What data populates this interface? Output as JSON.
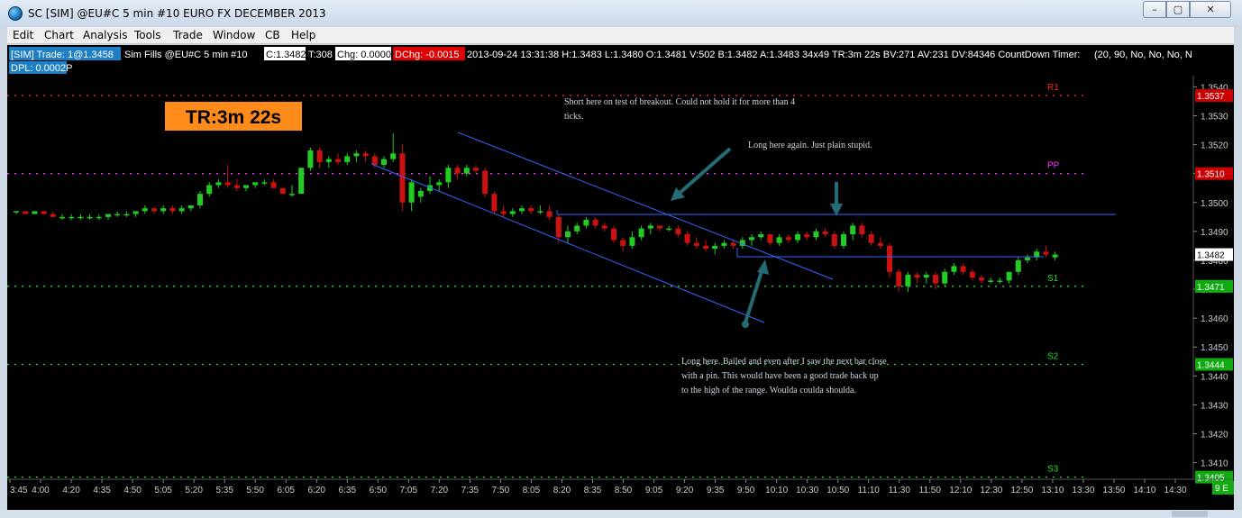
{
  "window": {
    "title": "SC [SIM] @EU#C  5 min   #10  EURO FX DECEMBER 2013",
    "btn_min": "–",
    "btn_max": "▢",
    "btn_close": "✕"
  },
  "menu": [
    "Edit",
    "Chart",
    "Analysis",
    "Tools",
    "Trade",
    "Window",
    "CB",
    "Help"
  ],
  "colors": {
    "background": "#000000",
    "up_candle": "#22cc22",
    "down_candle": "#cc1111",
    "pivot_pp": "#ff33ff",
    "resistance": "#ff2222",
    "support": "#22dd22",
    "trendline": "#3366ff",
    "timer_box": "#ff8c1a",
    "arrow": "#246b73"
  },
  "header": {
    "sim": "[SIM]  Trade: 1@1.3458",
    "fills": "Sim Fills  @EU#C  5 min   #10",
    "close": "C:1.3482",
    "ticks": "T:308",
    "chg": "Chg: 0.0000",
    "dchg": "DChg: -0.0015",
    "rest": "2013-09-24 13:31:38 H:1.3483 L:1.3480 O:1.3481 V:502 B:1.3482 A:1.3483 34x49 TR:3m 22s BV:271 AV:231 DV:84346  CountDown Timer:",
    "params": "(20, 90, No, No, No, N",
    "dpl": "DPL: 0.0002P"
  },
  "timer_label": "TR:3m 22s",
  "annotations": {
    "short": [
      "Short here on test of breakout. Could not hold it for more than 4",
      "ticks."
    ],
    "long_again": [
      "Long here again. Just plain stupid."
    ],
    "long_here": [
      "Long here. Bailed and even after I saw the next bar close",
      "with a pin. This would have been a good trade back up",
      "to the high of the range. Woulda coulda shoulda."
    ]
  },
  "levels": [
    {
      "name": "R1",
      "value": 1.3537,
      "label": "1.3537",
      "color": "#ff2222",
      "tag_bg": "#cc0000"
    },
    {
      "name": "PP",
      "value": 1.351,
      "label": "1.3510",
      "color": "#ff33ff",
      "tag_bg": "#cc0000"
    },
    {
      "name": "S1",
      "value": 1.3471,
      "label": "1.3471",
      "color": "#22dd22",
      "tag_bg": "#11aa11"
    },
    {
      "name": "S2",
      "value": 1.3444,
      "label": "1.3444",
      "color": "#22dd22",
      "tag_bg": "#11aa11"
    },
    {
      "name": "S3",
      "value": 1.3405,
      "label": "1.3405",
      "color": "#22dd22",
      "tag_bg": "#11aa11"
    }
  ],
  "chart_data": {
    "type": "candlestick",
    "symbol": "@EU#C",
    "interval": "5 min",
    "ylim": [
      1.3398,
      1.3552
    ],
    "y_ticks": [
      1.354,
      1.353,
      1.352,
      1.351,
      1.35,
      1.349,
      1.348,
      1.347,
      1.346,
      1.345,
      1.344,
      1.343,
      1.342,
      1.341
    ],
    "y_tick_labels": [
      "1.3540",
      "1.3530",
      "1.3520",
      "1.3510",
      "1.3500",
      "1.3490",
      "1.3480",
      "1.3470",
      "1.3460",
      "1.3450",
      "1.3440",
      "1.3430",
      "1.3420",
      "1.3410"
    ],
    "x_ticks": [
      "3:45",
      "4:00",
      "4:20",
      "4:35",
      "4:50",
      "5:05",
      "5:20",
      "5:35",
      "5:50",
      "6:05",
      "6:20",
      "6:35",
      "6:50",
      "7:05",
      "7:20",
      "7:35",
      "7:50",
      "8:05",
      "8:20",
      "8:35",
      "8:50",
      "9:05",
      "9:20",
      "9:35",
      "9:50",
      "10:10",
      "10:30",
      "10:50",
      "11:10",
      "11:30",
      "11:50",
      "12:10",
      "12:30",
      "12:50",
      "13:10",
      "13:30",
      "13:50",
      "14:10",
      "14:30"
    ],
    "last_price": {
      "value": 1.3482,
      "label": "1.3482"
    },
    "corner_label": "9 E",
    "candles": [
      [
        1.3497,
        1.3497,
        1.3496,
        1.3497
      ],
      [
        1.3497,
        1.3497,
        1.3496,
        1.3496
      ],
      [
        1.3496,
        1.3497,
        1.3496,
        1.3497
      ],
      [
        1.3497,
        1.3497,
        1.3496,
        1.3496
      ],
      [
        1.3496,
        1.3497,
        1.3495,
        1.3495
      ],
      [
        1.3495,
        1.3496,
        1.3494,
        1.3495
      ],
      [
        1.3495,
        1.3496,
        1.3494,
        1.3495
      ],
      [
        1.3495,
        1.3496,
        1.3494,
        1.3495
      ],
      [
        1.3495,
        1.3496,
        1.3494,
        1.3495
      ],
      [
        1.3495,
        1.3496,
        1.3494,
        1.3495
      ],
      [
        1.3495,
        1.3496,
        1.3494,
        1.3496
      ],
      [
        1.3496,
        1.3497,
        1.3495,
        1.3496
      ],
      [
        1.3496,
        1.3497,
        1.3495,
        1.3496
      ],
      [
        1.3496,
        1.3497,
        1.3495,
        1.3497
      ],
      [
        1.3497,
        1.3499,
        1.3496,
        1.3498
      ],
      [
        1.3498,
        1.3498,
        1.3496,
        1.3497
      ],
      [
        1.3497,
        1.3499,
        1.3496,
        1.3498
      ],
      [
        1.3498,
        1.3499,
        1.3496,
        1.3497
      ],
      [
        1.3497,
        1.3499,
        1.3496,
        1.3498
      ],
      [
        1.3498,
        1.3499,
        1.3497,
        1.3499
      ],
      [
        1.3499,
        1.3504,
        1.3498,
        1.3503
      ],
      [
        1.3503,
        1.3507,
        1.3502,
        1.3506
      ],
      [
        1.3506,
        1.3508,
        1.3505,
        1.3507
      ],
      [
        1.3507,
        1.3513,
        1.3505,
        1.3506
      ],
      [
        1.3506,
        1.3508,
        1.3504,
        1.3505
      ],
      [
        1.3505,
        1.3506,
        1.3504,
        1.3506
      ],
      [
        1.3506,
        1.3507,
        1.3505,
        1.3507
      ],
      [
        1.3507,
        1.3508,
        1.3506,
        1.3507
      ],
      [
        1.3507,
        1.3508,
        1.3506,
        1.3505
      ],
      [
        1.3505,
        1.3505,
        1.3503,
        1.3503
      ],
      [
        1.3503,
        1.3506,
        1.3502,
        1.3503
      ],
      [
        1.3503,
        1.3512,
        1.3503,
        1.3512
      ],
      [
        1.3512,
        1.3519,
        1.3511,
        1.3518
      ],
      [
        1.3518,
        1.3519,
        1.3512,
        1.3514
      ],
      [
        1.3514,
        1.3516,
        1.3512,
        1.3515
      ],
      [
        1.3515,
        1.3517,
        1.3513,
        1.3514
      ],
      [
        1.3514,
        1.3517,
        1.3513,
        1.3516
      ],
      [
        1.3516,
        1.3518,
        1.3514,
        1.3517
      ],
      [
        1.3517,
        1.3518,
        1.3514,
        1.3516
      ],
      [
        1.3516,
        1.3517,
        1.3512,
        1.3513
      ],
      [
        1.3513,
        1.3516,
        1.3512,
        1.3515
      ],
      [
        1.3515,
        1.3524,
        1.3514,
        1.3517
      ],
      [
        1.3517,
        1.352,
        1.3497,
        1.35
      ],
      [
        1.35,
        1.3508,
        1.3497,
        1.3507
      ],
      [
        1.3502,
        1.3505,
        1.35,
        1.3504
      ],
      [
        1.3504,
        1.3509,
        1.3503,
        1.3506
      ],
      [
        1.3506,
        1.3508,
        1.3504,
        1.3507
      ],
      [
        1.3507,
        1.3513,
        1.3505,
        1.3512
      ],
      [
        1.3512,
        1.3513,
        1.3508,
        1.351
      ],
      [
        1.351,
        1.3513,
        1.3509,
        1.3512
      ],
      [
        1.3512,
        1.3513,
        1.351,
        1.3511
      ],
      [
        1.3511,
        1.3512,
        1.3502,
        1.3503
      ],
      [
        1.3503,
        1.3504,
        1.3496,
        1.3497
      ],
      [
        1.3497,
        1.3499,
        1.3495,
        1.3496
      ],
      [
        1.3496,
        1.3498,
        1.3495,
        1.3497
      ],
      [
        1.3497,
        1.3499,
        1.3496,
        1.3498
      ],
      [
        1.3498,
        1.3499,
        1.3496,
        1.3497
      ],
      [
        1.3497,
        1.3499,
        1.3496,
        1.3497
      ],
      [
        1.3497,
        1.3499,
        1.3494,
        1.3495
      ],
      [
        1.3495,
        1.3496,
        1.3486,
        1.3488
      ],
      [
        1.3488,
        1.3492,
        1.3486,
        1.349
      ],
      [
        1.349,
        1.3493,
        1.3489,
        1.3492
      ],
      [
        1.3492,
        1.3495,
        1.3491,
        1.3494
      ],
      [
        1.3494,
        1.3495,
        1.3491,
        1.3492
      ],
      [
        1.3492,
        1.3493,
        1.349,
        1.3491
      ],
      [
        1.3491,
        1.3492,
        1.3486,
        1.3487
      ],
      [
        1.3487,
        1.3488,
        1.3483,
        1.3485
      ],
      [
        1.3485,
        1.349,
        1.3484,
        1.3488
      ],
      [
        1.3488,
        1.3492,
        1.3487,
        1.3491
      ],
      [
        1.3491,
        1.3493,
        1.3489,
        1.3492
      ],
      [
        1.3492,
        1.3492,
        1.349,
        1.3491
      ],
      [
        1.3491,
        1.3492,
        1.349,
        1.3491
      ],
      [
        1.3491,
        1.3492,
        1.3488,
        1.3489
      ],
      [
        1.3489,
        1.349,
        1.3485,
        1.3486
      ],
      [
        1.3486,
        1.3488,
        1.3484,
        1.3485
      ],
      [
        1.3485,
        1.3487,
        1.3483,
        1.3484
      ],
      [
        1.3484,
        1.3486,
        1.3482,
        1.3485
      ],
      [
        1.3485,
        1.3487,
        1.3484,
        1.3486
      ],
      [
        1.3486,
        1.3487,
        1.3484,
        1.3485
      ],
      [
        1.3485,
        1.3488,
        1.3484,
        1.3487
      ],
      [
        1.3487,
        1.3489,
        1.3485,
        1.3488
      ],
      [
        1.3488,
        1.349,
        1.3487,
        1.3489
      ],
      [
        1.3489,
        1.3489,
        1.3485,
        1.3486
      ],
      [
        1.3486,
        1.3489,
        1.3485,
        1.3488
      ],
      [
        1.3488,
        1.3489,
        1.3486,
        1.3487
      ],
      [
        1.3487,
        1.349,
        1.3486,
        1.3489
      ],
      [
        1.3489,
        1.349,
        1.3487,
        1.3488
      ],
      [
        1.3488,
        1.3491,
        1.3487,
        1.349
      ],
      [
        1.349,
        1.3491,
        1.3488,
        1.3489
      ],
      [
        1.3489,
        1.349,
        1.3484,
        1.3485
      ],
      [
        1.3485,
        1.349,
        1.3484,
        1.3489
      ],
      [
        1.3489,
        1.3493,
        1.3487,
        1.3492
      ],
      [
        1.3492,
        1.3493,
        1.3488,
        1.3489
      ],
      [
        1.3489,
        1.349,
        1.3485,
        1.3486
      ],
      [
        1.3486,
        1.3488,
        1.3484,
        1.3485
      ],
      [
        1.3485,
        1.3486,
        1.3474,
        1.3476
      ],
      [
        1.3476,
        1.3477,
        1.3469,
        1.3471
      ],
      [
        1.3471,
        1.3476,
        1.3469,
        1.3475
      ],
      [
        1.3475,
        1.3476,
        1.3472,
        1.3474
      ],
      [
        1.3474,
        1.3476,
        1.3472,
        1.3475
      ],
      [
        1.3475,
        1.3476,
        1.347,
        1.3472
      ],
      [
        1.3472,
        1.3477,
        1.3471,
        1.3476
      ],
      [
        1.3476,
        1.3479,
        1.3475,
        1.3478
      ],
      [
        1.3478,
        1.3479,
        1.3475,
        1.3476
      ],
      [
        1.3476,
        1.3477,
        1.3473,
        1.3474
      ],
      [
        1.3474,
        1.3475,
        1.3472,
        1.3473
      ],
      [
        1.3473,
        1.3474,
        1.3472,
        1.3473
      ],
      [
        1.3473,
        1.3474,
        1.3472,
        1.3473
      ],
      [
        1.3473,
        1.3476,
        1.3472,
        1.3476
      ],
      [
        1.3476,
        1.3481,
        1.3475,
        1.348
      ],
      [
        1.348,
        1.3482,
        1.3479,
        1.3481
      ],
      [
        1.3481,
        1.3484,
        1.348,
        1.3483
      ],
      [
        1.3483,
        1.3485,
        1.3481,
        1.3482
      ],
      [
        1.3481,
        1.3483,
        1.348,
        1.3482
      ]
    ]
  }
}
